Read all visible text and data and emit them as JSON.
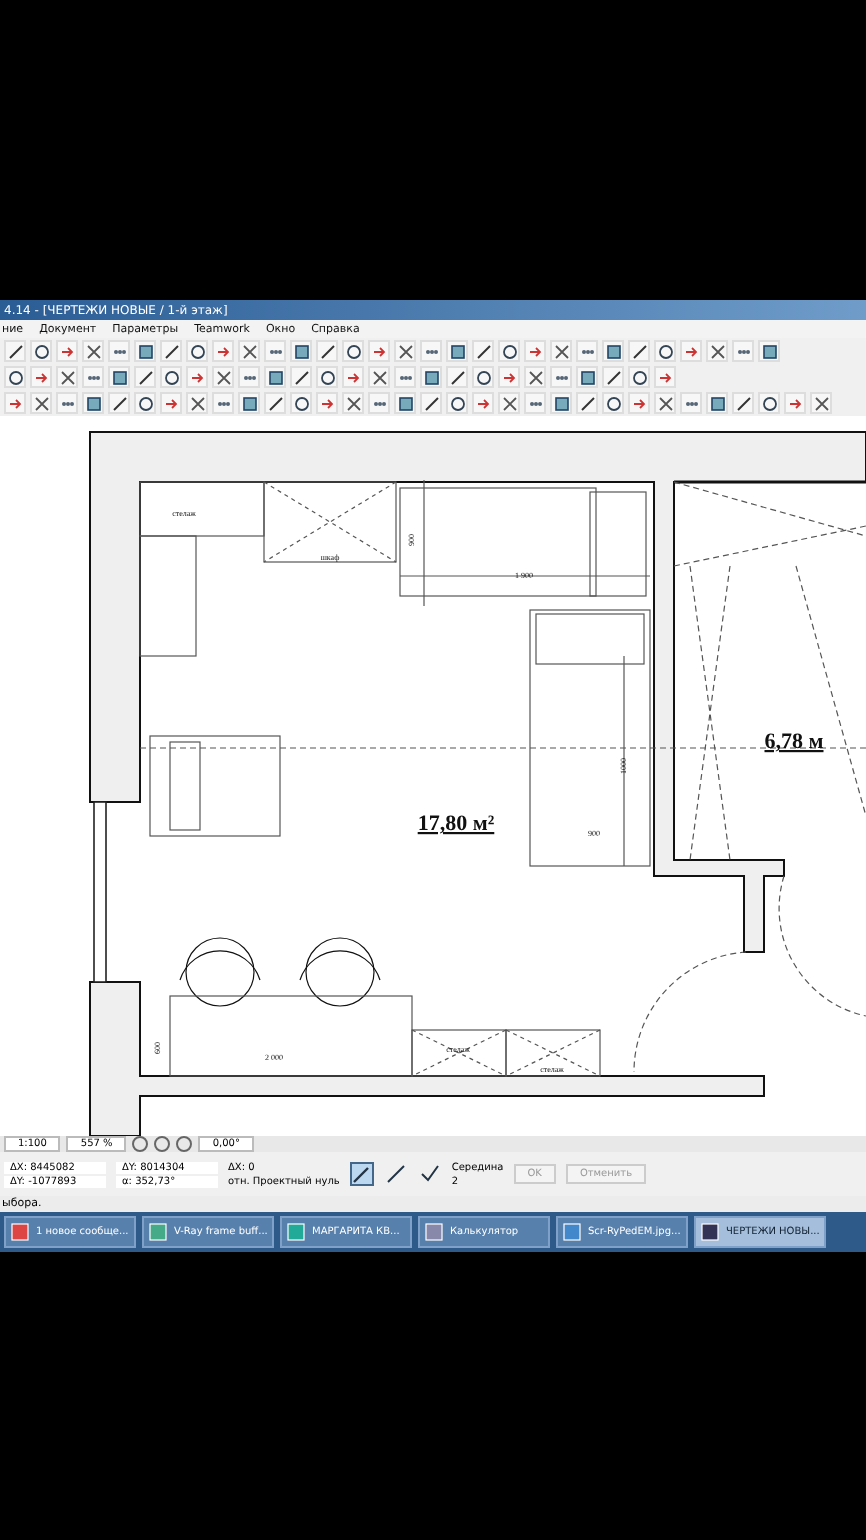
{
  "window": {
    "title": "4.14 - [ЧЕРТЕЖИ НОВЫЕ / 1-й этаж]"
  },
  "menu": [
    "ние",
    "Документ",
    "Параметры",
    "Teamwork",
    "Окно",
    "Справка"
  ],
  "plan": {
    "labels": [
      {
        "kind": "note",
        "text": "стелаж"
      },
      {
        "kind": "note",
        "text": "шкаф"
      },
      {
        "kind": "dim",
        "text": "1 900"
      },
      {
        "kind": "vdim",
        "text": "900"
      },
      {
        "kind": "vdim",
        "text": "1000"
      },
      {
        "kind": "dim",
        "text": "900"
      },
      {
        "kind": "area",
        "text": "17,80 м²"
      },
      {
        "kind": "area",
        "text": "6,78 м"
      },
      {
        "kind": "vdim",
        "text": "600"
      },
      {
        "kind": "dim",
        "text": "2 000"
      },
      {
        "kind": "note",
        "text": "стелаж"
      },
      {
        "kind": "note",
        "text": "стелаж"
      }
    ]
  },
  "nav": {
    "scale": "1:100",
    "zoom": "557 %",
    "angle": "0,00°"
  },
  "info": {
    "coords": [
      "ΔX: 8445082",
      "ΔY: -1077893"
    ],
    "polar": [
      "ΔY: 8014304",
      "α: 352,73°"
    ],
    "origin": [
      "ΔX: 0",
      "отн. Проектный нуль"
    ],
    "snap": [
      "Середина",
      "2"
    ]
  },
  "buttons": [
    {
      "label": "OK",
      "disabled": true
    },
    {
      "label": "Отменить",
      "disabled": true
    }
  ],
  "status_bar": "ыбора.",
  "taskbar": [
    {
      "label": "1 новое сообще...",
      "selected": false
    },
    {
      "label": "V-Ray frame buff...",
      "selected": false
    },
    {
      "label": "МАРГАРИТА КВ...",
      "selected": false
    },
    {
      "label": "Калькулятор",
      "selected": false
    },
    {
      "label": "Scr-RyPedEM.jpg...",
      "selected": false
    },
    {
      "label": "ЧЕРТЕЖИ НОВЫ...",
      "selected": true
    }
  ]
}
